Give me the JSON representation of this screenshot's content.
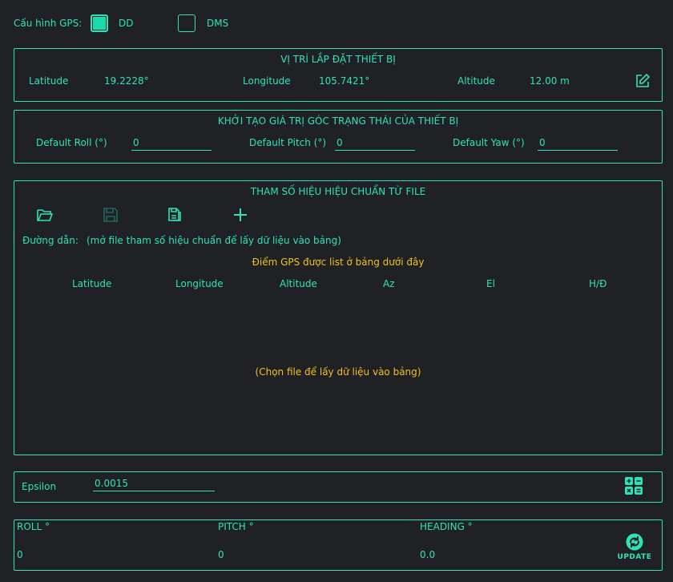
{
  "gps_config": {
    "label": "Cấu hình GPS:",
    "options": [
      {
        "label": "DD",
        "checked": true
      },
      {
        "label": "DMS",
        "checked": false
      }
    ]
  },
  "install_position": {
    "title": "VỊ TRÍ LẮP ĐẶT THIẾT BỊ",
    "latitude_label": "Latitude",
    "latitude_value": "19.2228°",
    "longitude_label": "Longitude",
    "longitude_value": "105.7421°",
    "altitude_label": "Altitude",
    "altitude_value": "12.00 m",
    "edit_icon": "edit-icon"
  },
  "init_angles": {
    "title": "KHỞI TẠO GIÁ TRỊ GÓC TRẠNG THÁI CỦA THIẾT BỊ",
    "roll_label": "Default Roll (°)",
    "roll_value": "0",
    "pitch_label": "Default Pitch (°)",
    "pitch_value": "0",
    "yaw_label": "Default Yaw (°)",
    "yaw_value": "0"
  },
  "calibration": {
    "title": "THAM SỐ HIỆU HIỆU CHUẨN TỪ FILE",
    "toolbar_icons": [
      "open-folder-icon",
      "save-icon",
      "copy-file-icon",
      "plus-icon"
    ],
    "path_label": "Đường dẫn:",
    "path_value": "(mở file tham số hiệu chuẩn để lấy dữ liệu vào bảng)",
    "list_caption": "Điểm GPS được list ở bảng dưới đây",
    "columns": [
      "Latitude",
      "Longitude",
      "Altitude",
      "Az",
      "El",
      "H/Đ"
    ],
    "empty_message": "(Chọn file để lấy dữ liệu vào bảng)"
  },
  "epsilon": {
    "label": "Epsilon",
    "value": "0.0015",
    "calc_icon": "calculator-icon"
  },
  "status": {
    "roll_label": "ROLL °",
    "roll_value": "0",
    "pitch_label": "PITCH °",
    "pitch_value": "0",
    "heading_label": "HEADING °",
    "heading_value": "0.0",
    "update_label": "UPDATE"
  },
  "colors": {
    "accent": "#2fe3b8",
    "highlight": "#f2c21c",
    "background": "#1f2124"
  }
}
